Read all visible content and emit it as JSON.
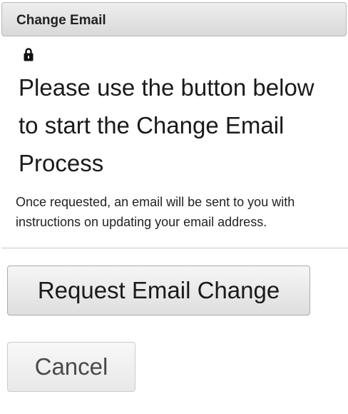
{
  "header": {
    "title": "Change Email"
  },
  "icons": {
    "status": "lock-icon"
  },
  "content": {
    "heading": "Please use the button below to start the Change Email Process",
    "description": "Once requested, an email will be sent to you with instructions on updating your email address."
  },
  "actions": {
    "request_label": "Request Email Change",
    "cancel_label": "Cancel"
  }
}
